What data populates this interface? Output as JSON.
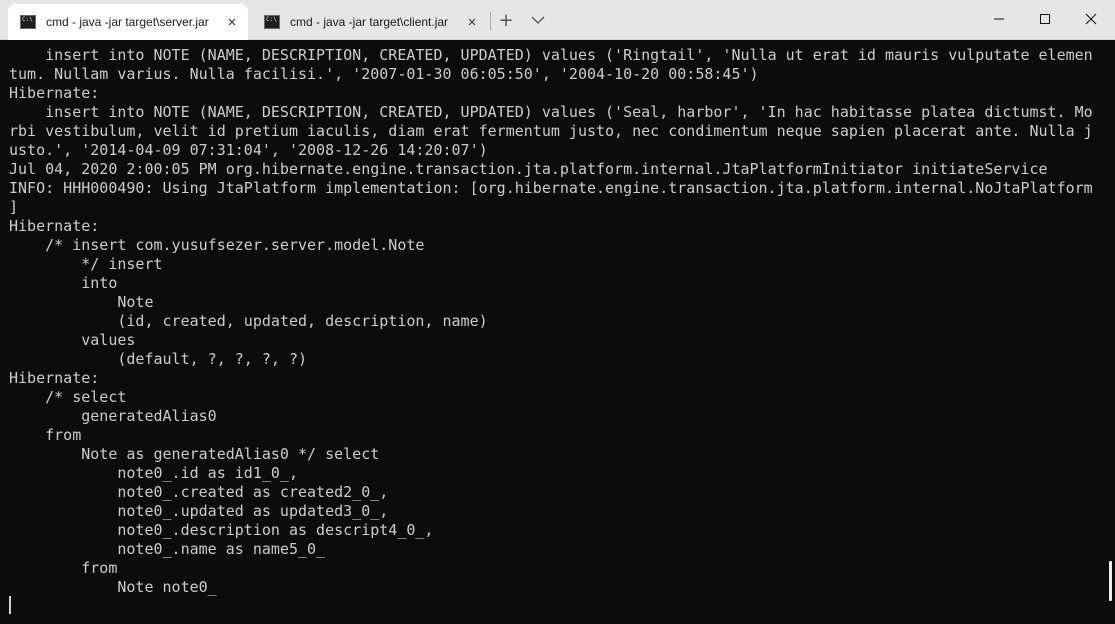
{
  "tabs": [
    {
      "label": "cmd - java  -jar target\\server.jar",
      "close_icon": "×",
      "active": true
    },
    {
      "label": "cmd - java  -jar target\\client.jar",
      "close_icon": "×",
      "active": false
    }
  ],
  "new_tab_icon": "+",
  "window_controls": {
    "close_glyph": "✕"
  },
  "terminal": {
    "lines": [
      "    insert into NOTE (NAME, DESCRIPTION, CREATED, UPDATED) values ('Ringtail', 'Nulla ut erat id mauris vulputate elemen",
      "tum. Nullam varius. Nulla facilisi.', '2007-01-30 06:05:50', '2004-10-20 00:58:45')",
      "Hibernate:",
      "    insert into NOTE (NAME, DESCRIPTION, CREATED, UPDATED) values ('Seal, harbor', 'In hac habitasse platea dictumst. Mo",
      "rbi vestibulum, velit id pretium iaculis, diam erat fermentum justo, nec condimentum neque sapien placerat ante. Nulla j",
      "usto.', '2014-04-09 07:31:04', '2008-12-26 14:20:07')",
      "Jul 04, 2020 2:00:05 PM org.hibernate.engine.transaction.jta.platform.internal.JtaPlatformInitiator initiateService",
      "INFO: HHH000490: Using JtaPlatform implementation: [org.hibernate.engine.transaction.jta.platform.internal.NoJtaPlatform",
      "]",
      "Hibernate:",
      "    /* insert com.yusufsezer.server.model.Note",
      "        */ insert",
      "        into",
      "            Note",
      "            (id, created, updated, description, name)",
      "        values",
      "            (default, ?, ?, ?, ?)",
      "Hibernate:",
      "    /* select",
      "        generatedAlias0",
      "    from",
      "        Note as generatedAlias0 */ select",
      "            note0_.id as id1_0_,",
      "            note0_.created as created2_0_,",
      "            note0_.updated as updated3_0_,",
      "            note0_.description as descript4_0_,",
      "            note0_.name as name5_0_",
      "        from",
      "            Note note0_"
    ]
  }
}
